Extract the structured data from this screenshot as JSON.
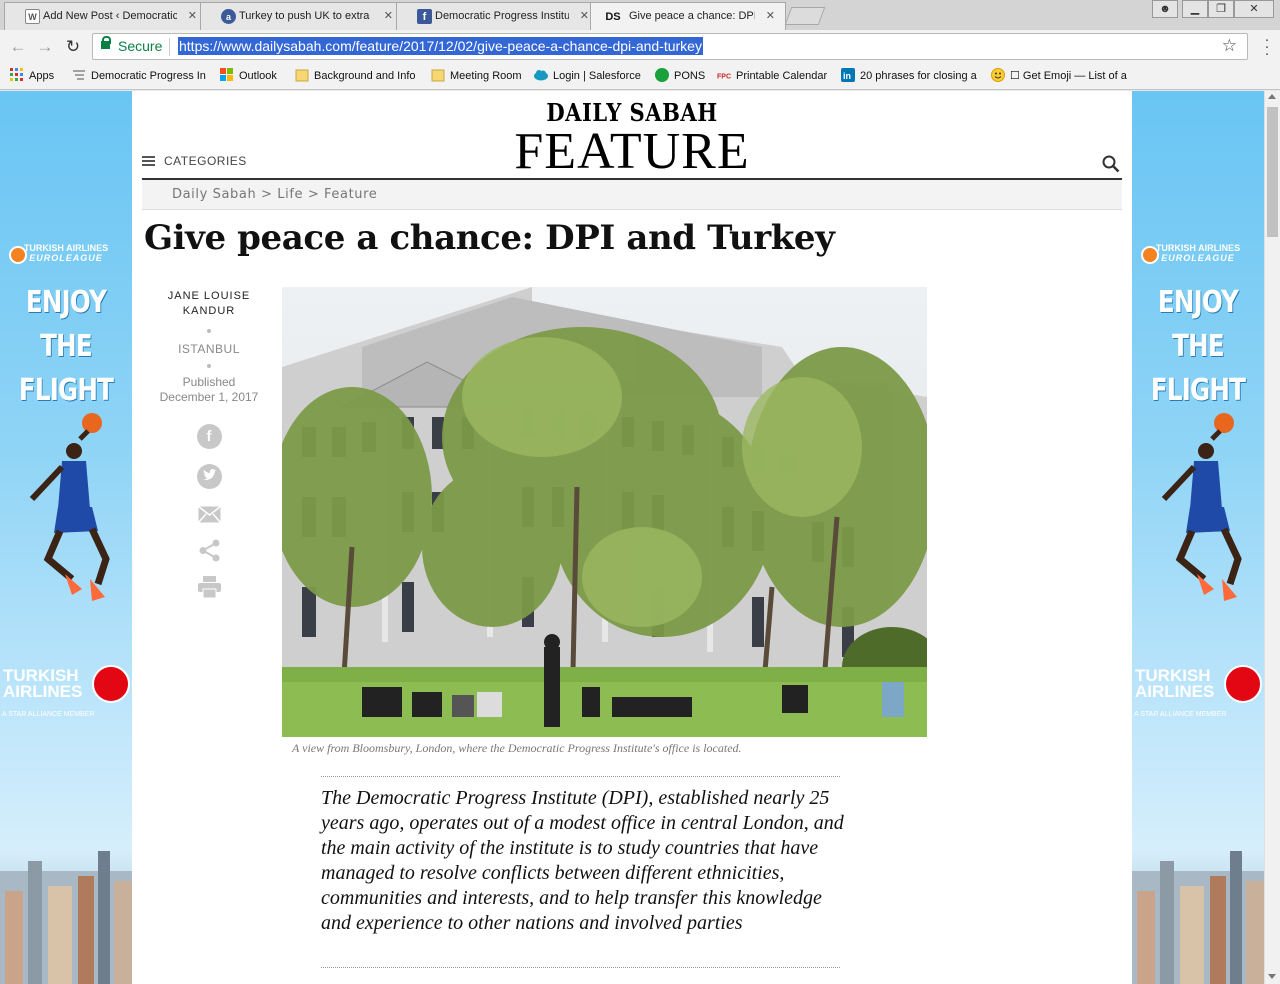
{
  "tabs": [
    {
      "title": "Add New Post ‹ Democratic",
      "icon": "wordpress-icon"
    },
    {
      "title": "Turkey to push UK to extra",
      "icon": "site-favicon"
    },
    {
      "title": "Democratic Progress Institu",
      "icon": "facebook-icon"
    },
    {
      "title": "Give peace a chance: DPI a",
      "icon": "daily-sabah-icon",
      "active": true
    }
  ],
  "toolbar": {
    "secure_label": "Secure",
    "url": "https://www.dailysabah.com/feature/2017/12/02/give-peace-a-chance-dpi-and-turkey"
  },
  "bookmarks": [
    {
      "label": "Apps",
      "icon": "apps-grid-icon"
    },
    {
      "label": "Democratic Progress In",
      "icon": "dpi-favicon"
    },
    {
      "label": "Outlook",
      "icon": "windows-icon"
    },
    {
      "label": "Background and Info",
      "icon": "folder-icon"
    },
    {
      "label": "Meeting Room",
      "icon": "folder-icon"
    },
    {
      "label": "Login | Salesforce",
      "icon": "salesforce-cloud-icon"
    },
    {
      "label": "PONS",
      "icon": "pons-icon"
    },
    {
      "label": "Printable Calendar",
      "icon": "calendar-favicon"
    },
    {
      "label": "20 phrases for closing a",
      "icon": "linkedin-icon"
    },
    {
      "label": "☐ Get Emoji — List of a",
      "icon": "emoji-icon"
    }
  ],
  "site": {
    "brand": "DAILY SABAH",
    "section": "FEATURE",
    "categories_label": "CATEGORIES",
    "breadcrumb": "Daily Sabah > Life > Feature"
  },
  "article": {
    "headline": "Give peace a chance: DPI and Turkey",
    "author_line1": "JANE LOUISE",
    "author_line2": "KANDUR",
    "location": "ISTANBUL",
    "published_label": "Published",
    "published_date": "December 1, 2017",
    "caption": "A view from Bloomsbury, London, where the Democratic Progress Institute's office is located.",
    "lead": "The Democratic Progress Institute (DPI), established nearly 25 years ago, operates out of a modest office in central London, and the main activity of the institute is to study countries that have managed to resolve conflicts between different ethnicities, communities and interests, and to help transfer this knowledge and experience to other nations and involved parties"
  },
  "ads": {
    "league_line1": "TURKISH AIRLINES",
    "league_line2": "EUROLEAGUE",
    "slogan_line1": "ENJOY",
    "slogan_line2": "THE FLIGHT",
    "airline_line1": "TURKISH",
    "airline_line2": "AIRLINES",
    "alliance": "A STAR ALLIANCE MEMBER"
  },
  "colors": {
    "secure_green": "#0b8043",
    "url_highlight": "#3367d6",
    "ad_sky": "#69c5f3",
    "airline_red": "#e30613"
  }
}
